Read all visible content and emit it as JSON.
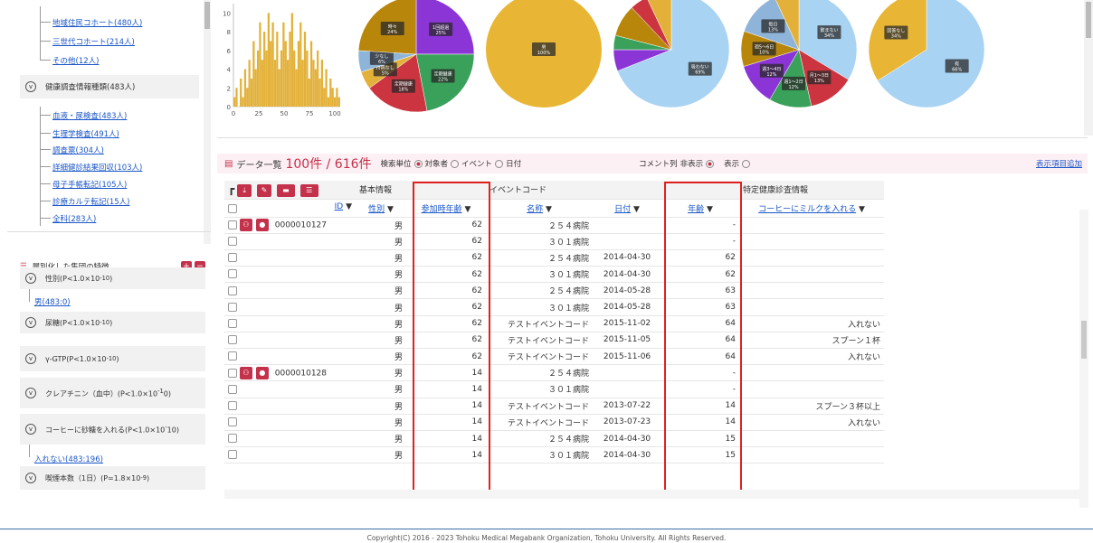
{
  "tree": {
    "items_top": [
      {
        "label": "地域住民コホート(480人)"
      },
      {
        "label": "三世代コホート(214人)"
      },
      {
        "label": "その他(12人)"
      }
    ],
    "group1": {
      "label": "健康調査情報種類(483人)"
    },
    "items_mid": [
      {
        "label": "血液・尿検査(483人)"
      },
      {
        "label": "生理学検査(491人)"
      },
      {
        "label": "調査票(304人)"
      },
      {
        "label": "詳細健診結果回収(103人)"
      },
      {
        "label": "母子手帳転記(105人)"
      },
      {
        "label": "診療カルテ転記(15人)"
      },
      {
        "label": "全科(283人)"
      }
    ]
  },
  "features": {
    "header": "層別化した集団の特徴",
    "items": [
      {
        "label": "性別(P<1.0×10",
        "sup": "-10",
        "tail": ")",
        "child": "男(483:0)"
      },
      {
        "label": "尿糖(P<1.0×10",
        "sup": "-10",
        "tail": ")",
        "child": ""
      },
      {
        "label": "γ-GTP(P<1.0×10",
        "sup": "-10",
        "tail": ")",
        "child": ""
      },
      {
        "label": "クレアチニン（血中）(P<1.0×10",
        "sup": "-1",
        "tail": "0)",
        "child": ""
      },
      {
        "label": "コーヒーに砂糖を入れる(P<1.0×10",
        "sup": "-",
        "tail": "10)",
        "child": "入れない(483:196)"
      },
      {
        "label": "喫煙本数（1日）(P=1.8×10",
        "sup": "-9",
        "tail": ")",
        "child": ""
      }
    ]
  },
  "chart_data": [
    {
      "type": "bar",
      "title": "",
      "xlabel": "",
      "ylabel": "",
      "x_ticks": [
        "0",
        "25",
        "50",
        "75",
        "100"
      ],
      "y_ticks": [
        "0",
        "2",
        "4",
        "6",
        "8",
        "10"
      ],
      "ylim": [
        0,
        11
      ],
      "xlim": [
        0,
        100
      ],
      "values": [
        1,
        2,
        0,
        3,
        1,
        4,
        2,
        5,
        3,
        7,
        4,
        6,
        9,
        5,
        8,
        6,
        10,
        7,
        9,
        5,
        8,
        4,
        6,
        9,
        7,
        5,
        8,
        10,
        6,
        4,
        7,
        9,
        5,
        8,
        6,
        3,
        7,
        5,
        4,
        6,
        3,
        5,
        2,
        4,
        1,
        3,
        2,
        1,
        2,
        1
      ],
      "bar_color": "#e3b13a"
    },
    {
      "type": "pie",
      "slices": [
        {
          "label": "1回超過",
          "value": 25,
          "color": "#8b35d6"
        },
        {
          "label": "定期健康",
          "value": 22,
          "color": "#3aa15a"
        },
        {
          "label": "定期健康",
          "value": 18,
          "color": "#cc3540"
        },
        {
          "label": "持病なし",
          "value": 5,
          "color": "#e3b13a"
        },
        {
          "label": "少なし",
          "value": 6,
          "color": "#8fb4d9"
        },
        {
          "label": "時々",
          "value": 24,
          "color": "#b8860b"
        }
      ]
    },
    {
      "type": "pie",
      "slices": [
        {
          "label": "男",
          "value": 100,
          "color": "#e8b634"
        }
      ]
    },
    {
      "type": "pie",
      "slices": [
        {
          "label": "吸わない",
          "value": 69,
          "color": "#a8d3f3"
        },
        {
          "label": "",
          "value": 6,
          "color": "#8b35d6"
        },
        {
          "label": "",
          "value": 4,
          "color": "#3aa15a"
        },
        {
          "label": "",
          "value": 9,
          "color": "#b8860b"
        },
        {
          "label": "",
          "value": 5,
          "color": "#cc3540"
        },
        {
          "label": "",
          "value": 7,
          "color": "#e3b13a"
        }
      ]
    },
    {
      "type": "pie",
      "slices": [
        {
          "label": "飲まない",
          "value": 34,
          "color": "#a8d3f3"
        },
        {
          "label": "月1〜3日",
          "value": 13,
          "color": "#cc3540"
        },
        {
          "label": "週1〜2日",
          "value": 12,
          "color": "#3aa15a"
        },
        {
          "label": "週3〜4日",
          "value": 12,
          "color": "#8b35d6"
        },
        {
          "label": "週5〜6日",
          "value": 10,
          "color": "#b8860b"
        },
        {
          "label": "毎日",
          "value": 13,
          "color": "#8fb4d9"
        },
        {
          "label": "",
          "value": 7,
          "color": "#e3b13a"
        }
      ]
    },
    {
      "type": "pie",
      "slices": [
        {
          "label": "有",
          "value": 66,
          "color": "#a8d3f3"
        },
        {
          "label": "回答なし",
          "value": 34,
          "color": "#e8b634"
        }
      ]
    }
  ],
  "toolbar": {
    "prefix": "データ一覧",
    "count": "100件 / 616件",
    "unit_label": "検索単位",
    "opt1": "対象者",
    "opt2": "イベント",
    "opt3": "日付",
    "comment_label": "コメント列",
    "hide": "非表示",
    "show": "表示",
    "add_items": "表示項目追加"
  },
  "table": {
    "groups": [
      "基本情報",
      "イベントコード",
      "特定健康診査情報"
    ],
    "cols": [
      "ID",
      "性別",
      "参加時年齢",
      "名称",
      "日付",
      "年齢",
      "コーヒーにミルクを入れる"
    ],
    "rows": [
      {
        "id": "0000010127",
        "sex": "男",
        "age": "62",
        "name": "２５４病院",
        "date": "",
        "eage": "-",
        "milk": ""
      },
      {
        "id": "",
        "sex": "男",
        "age": "62",
        "name": "３０１病院",
        "date": "",
        "eage": "-",
        "milk": ""
      },
      {
        "id": "",
        "sex": "男",
        "age": "62",
        "name": "２５４病院",
        "date": "2014-04-30",
        "eage": "62",
        "milk": ""
      },
      {
        "id": "",
        "sex": "男",
        "age": "62",
        "name": "３０１病院",
        "date": "2014-04-30",
        "eage": "62",
        "milk": ""
      },
      {
        "id": "",
        "sex": "男",
        "age": "62",
        "name": "２５４病院",
        "date": "2014-05-28",
        "eage": "63",
        "milk": ""
      },
      {
        "id": "",
        "sex": "男",
        "age": "62",
        "name": "３０１病院",
        "date": "2014-05-28",
        "eage": "63",
        "milk": ""
      },
      {
        "id": "",
        "sex": "男",
        "age": "62",
        "name": "テストイベントコード",
        "date": "2015-11-02",
        "eage": "64",
        "milk": "入れない"
      },
      {
        "id": "",
        "sex": "男",
        "age": "62",
        "name": "テストイベントコード",
        "date": "2015-11-05",
        "eage": "64",
        "milk": "スプーン１杯"
      },
      {
        "id": "",
        "sex": "男",
        "age": "62",
        "name": "テストイベントコード",
        "date": "2015-11-06",
        "eage": "64",
        "milk": "入れない"
      },
      {
        "id": "0000010128",
        "sex": "男",
        "age": "14",
        "name": "２５４病院",
        "date": "",
        "eage": "-",
        "milk": ""
      },
      {
        "id": "",
        "sex": "男",
        "age": "14",
        "name": "３０１病院",
        "date": "",
        "eage": "-",
        "milk": ""
      },
      {
        "id": "",
        "sex": "男",
        "age": "14",
        "name": "テストイベントコード",
        "date": "2013-07-22",
        "eage": "14",
        "milk": "スプーン３杯以上"
      },
      {
        "id": "",
        "sex": "男",
        "age": "14",
        "name": "テストイベントコード",
        "date": "2013-07-23",
        "eage": "14",
        "milk": "入れない"
      },
      {
        "id": "",
        "sex": "男",
        "age": "14",
        "name": "２５４病院",
        "date": "2014-04-30",
        "eage": "15",
        "milk": ""
      },
      {
        "id": "",
        "sex": "男",
        "age": "14",
        "name": "３０１病院",
        "date": "2014-04-30",
        "eage": "15",
        "milk": ""
      }
    ]
  },
  "footer": "Copyright(C) 2016 - 2023 Tohoku Medical Megabank Organization, Tohoku University. All Rights Reserved."
}
